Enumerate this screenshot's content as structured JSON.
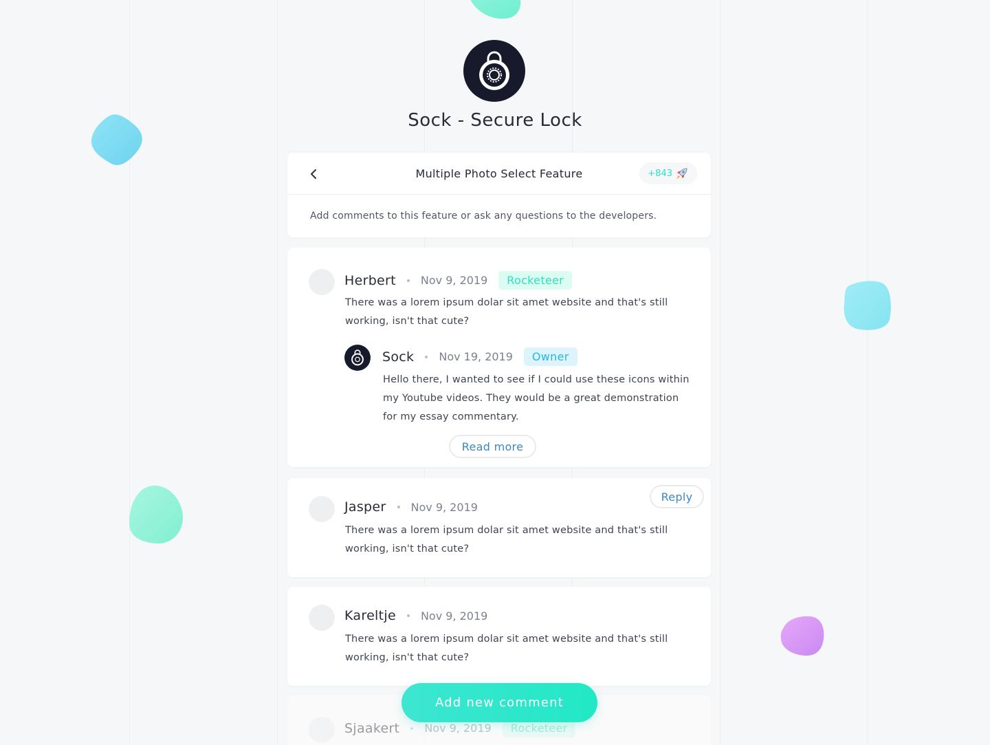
{
  "app": {
    "name": "Sock - Secure Lock",
    "logo_icon": "combination-lock-icon"
  },
  "feature": {
    "title": "Multiple Photo Select Feature",
    "votes": "+843",
    "vote_icon": "rocket-icon",
    "description": "Add comments to this feature or ask any questions to the developers."
  },
  "comments": [
    {
      "author": "Herbert",
      "date": "Nov 9, 2019",
      "badge": "Rocketeer",
      "text_lines": [
        "There was a lorem ipsum dolar sit amet website and that's still",
        "working, isn't that cute?"
      ],
      "reply": {
        "author": "Sock",
        "date": "Nov 19, 2019",
        "badge": "Owner",
        "text_lines": [
          "Hello there, I wanted to see if I could use these icons within",
          "my Youtube videos. They would be a great demonstration",
          "for my essay commentary."
        ],
        "read_more_label": "Read more"
      }
    },
    {
      "author": "Jasper",
      "date": "Nov 9, 2019",
      "reply_label": "Reply",
      "text_lines": [
        "There was a lorem ipsum dolar sit amet website and that's still",
        "working, isn't that cute?"
      ]
    },
    {
      "author": "Kareltje",
      "date": "Nov 9, 2019",
      "text_lines": [
        "There was a lorem ipsum dolar sit amet website and that's still",
        "working, isn't that cute?"
      ]
    },
    {
      "author": "Sjaakert",
      "date": "Nov 9, 2019",
      "badge": "Rocketeer"
    }
  ],
  "add_comment_label": "Add new comment",
  "colors": {
    "accent": "#2ee0c6",
    "owner_badge": "#25b5e8",
    "link_blue": "#3f87c0",
    "logo_dark": "#171a2b"
  }
}
